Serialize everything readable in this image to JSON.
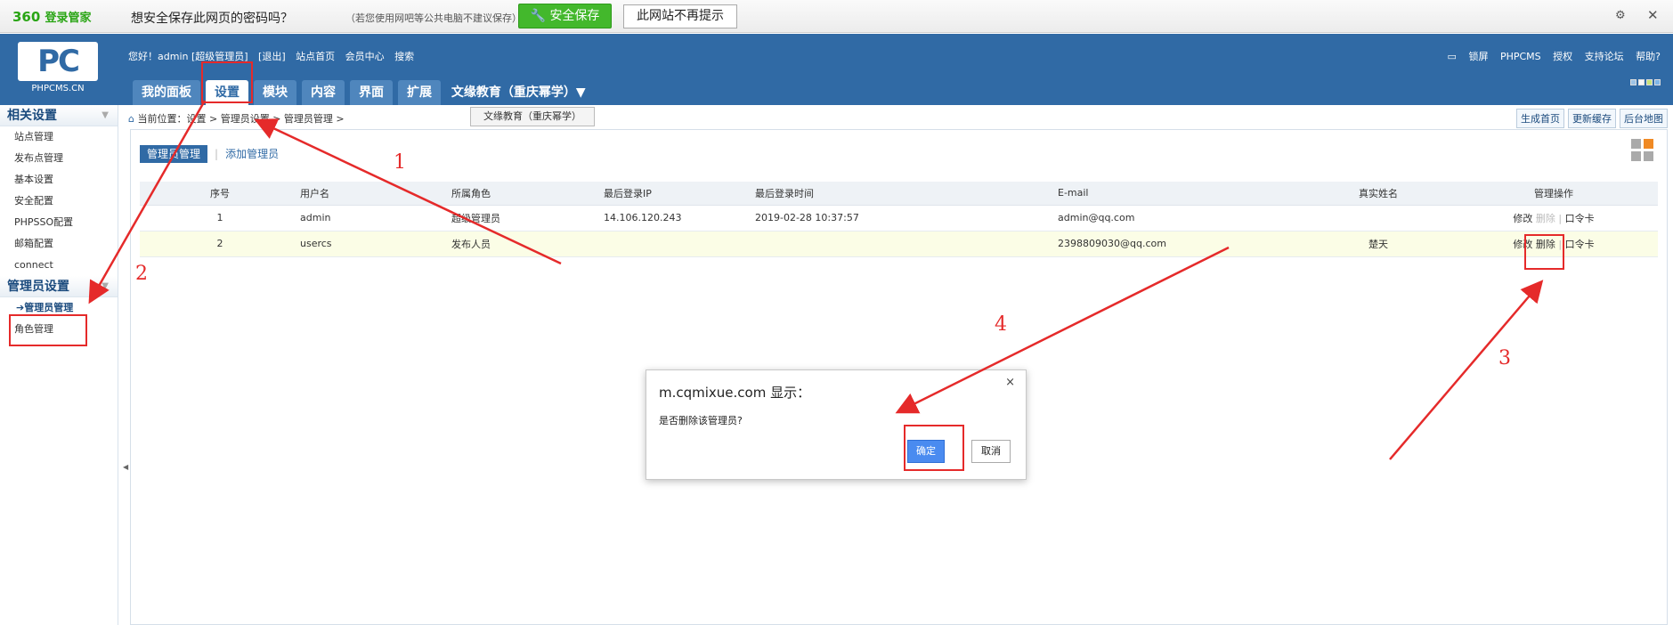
{
  "pwbar": {
    "brand": "360",
    "brand_sub": "登录管家",
    "question": "想安全保存此网页的密码吗？",
    "note": "（若您使用网吧等公共电脑不建议保存）",
    "save_label": "安全保存",
    "never_label": "此网站不再提示",
    "gear_icon": "gear-icon",
    "close_label": "✕"
  },
  "header": {
    "logo_text": "PC",
    "logo_sub": "PHPCMS.CN",
    "user_greeting": "您好！admin [超级管理员]",
    "logout": "[退出]",
    "site_home": "站点首页",
    "member_center": "会员中心",
    "search": "搜索",
    "right_links": [
      "锁屏",
      "PHPCMS",
      "授权",
      "支持论坛",
      "帮助?"
    ],
    "tabs": [
      "我的面板",
      "设置",
      "模块",
      "内容",
      "界面",
      "扩展"
    ],
    "active_tab": "设置",
    "site_name": "文缘教育（重庆幂学）▼",
    "site_tip": "文缘教育（重庆幂学）"
  },
  "sidebar": {
    "section1": "相关设置",
    "items1": [
      "站点管理",
      "发布点管理",
      "基本设置",
      "安全配置",
      "PHPSSO配置",
      "邮箱配置",
      "connect"
    ],
    "section2": "管理员设置",
    "items2": [
      "管理员管理",
      "角色管理"
    ]
  },
  "breadcrumb": {
    "text": "当前位置：设置 > 管理员设置 > 管理员管理 >",
    "buttons": [
      "生成首页",
      "更新缓存",
      "后台地图"
    ]
  },
  "subtabs": {
    "active": "管理员管理",
    "other": "添加管理员"
  },
  "table": {
    "headers": [
      "序号",
      "用户名",
      "所属角色",
      "最后登录IP",
      "最后登录时间",
      "E-mail",
      "真实姓名",
      "管理操作"
    ],
    "rows": [
      {
        "id": "1",
        "user": "admin",
        "role": "超级管理员",
        "ip": "14.106.120.243",
        "time": "2019-02-28 10:37:57",
        "email": "admin@qq.com",
        "name": "",
        "edit": "修改",
        "del": "删除",
        "card": "口令卡"
      },
      {
        "id": "2",
        "user": "usercs",
        "role": "发布人员",
        "ip": "",
        "time": "",
        "email": "2398809030@qq.com",
        "name": "楚天",
        "edit": "修改",
        "del": "删除",
        "card": "口令卡"
      }
    ]
  },
  "dialog": {
    "title": "m.cqmixue.com 显示：",
    "message": "是否删除该管理员?",
    "ok": "确定",
    "cancel": "取消",
    "close": "×"
  },
  "annotations": [
    "1",
    "2",
    "3",
    "4"
  ],
  "colors": {
    "header": "#306aa5",
    "annotation": "#e52a2a",
    "save_green": "#43b82c"
  }
}
